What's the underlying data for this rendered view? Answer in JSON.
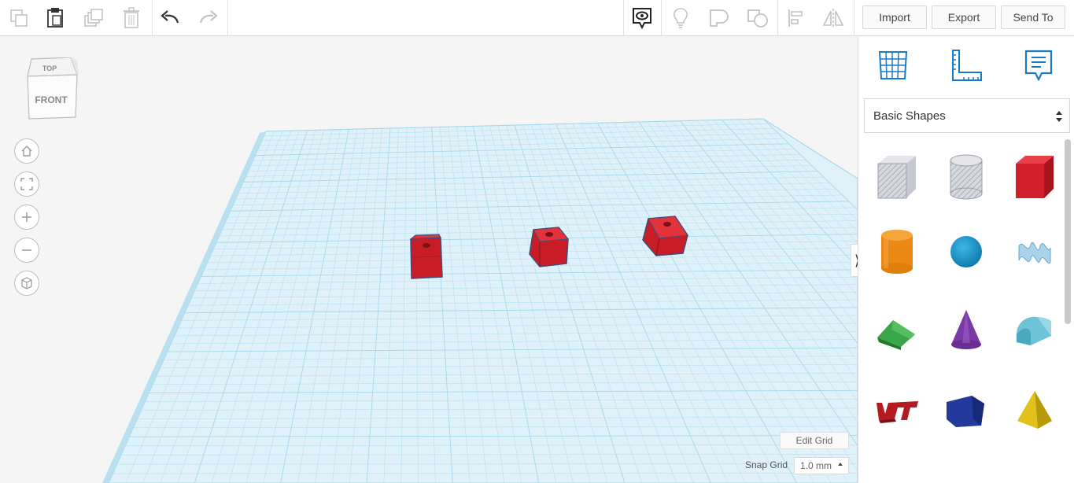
{
  "toolbar": {
    "import_label": "Import",
    "export_label": "Export",
    "send_to_label": "Send To",
    "icons": [
      "copy-icon",
      "paste-icon",
      "duplicate-icon",
      "delete-icon",
      "undo-icon",
      "redo-icon",
      "show-all-icon",
      "lightbulb-icon",
      "group-icon",
      "ungroup-icon",
      "align-icon",
      "mirror-icon"
    ]
  },
  "viewcube": {
    "top_label": "TOP",
    "front_label": "FRONT"
  },
  "nav": [
    "home-icon",
    "fit-view-icon",
    "zoom-in-icon",
    "zoom-out-icon",
    "perspective-icon"
  ],
  "grid": {
    "edit_label": "Edit Grid",
    "snap_label": "Snap Grid",
    "snap_value": "1.0 mm"
  },
  "workplane": {
    "plane_color": "#d4eef8",
    "line_color": "#a6d8ec",
    "object_color": "#d21f2b"
  },
  "panel": {
    "tabs": [
      "workplane-icon",
      "ruler-icon",
      "notes-icon"
    ],
    "category": "Basic Shapes",
    "shapes": [
      "box-hole",
      "cylinder-hole",
      "box",
      "cylinder",
      "sphere",
      "scribble",
      "roof",
      "cone",
      "round-roof",
      "text",
      "wedge-prism",
      "pyramid"
    ]
  }
}
